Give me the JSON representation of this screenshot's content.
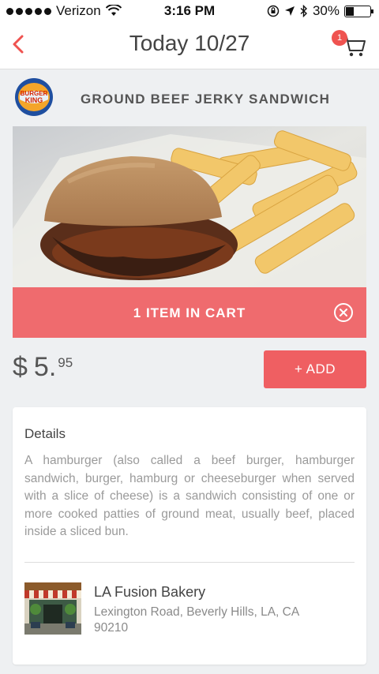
{
  "status_bar": {
    "carrier": "Verizon",
    "time": "3:16 PM",
    "battery_label": "30%",
    "battery_level": 0.3
  },
  "nav": {
    "title": "Today 10/27",
    "cart_count": "1",
    "accent": "#ef5350"
  },
  "product": {
    "brand_logo_text": "BURGER KING",
    "name": "GROUND BEEF JERKY SANDWICH",
    "cart_status": "1 ITEM IN CART",
    "price_currency": "$",
    "price_main": "5.",
    "price_cents": "95",
    "add_label": "+ ADD"
  },
  "details": {
    "title": "Details",
    "text": "A hamburger (also called a beef burger, hamburger sandwich, burger, hamburg or cheeseburger when served with a slice of cheese) is a sandwich consisting of one or more cooked patties of ground meat, usually beef, placed inside a sliced bun."
  },
  "store": {
    "name": "LA Fusion Bakery",
    "address": "Lexington Road, Beverly Hills, LA, CA 90210"
  }
}
